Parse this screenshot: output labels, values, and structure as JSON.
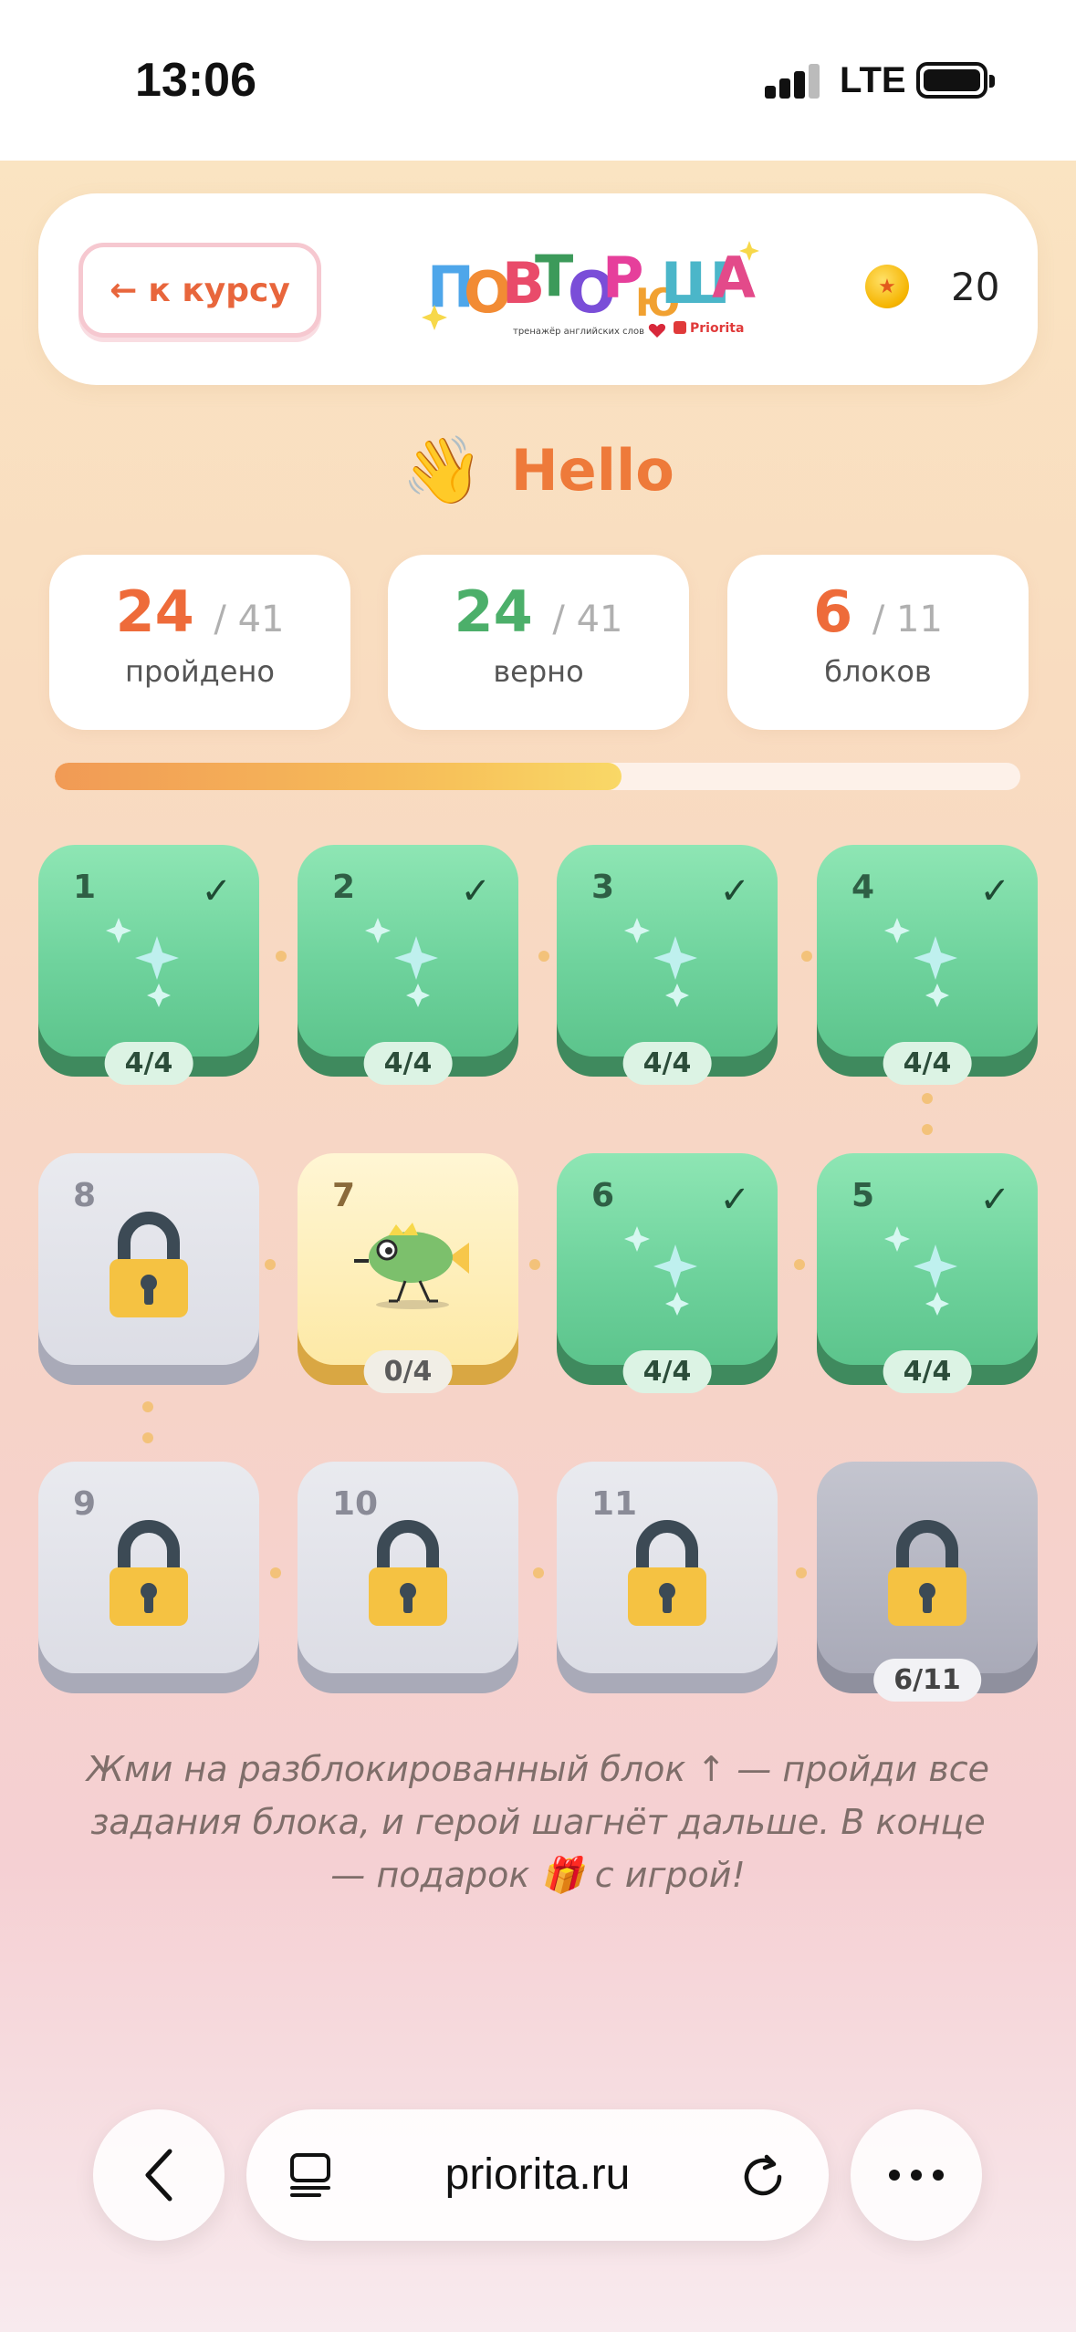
{
  "status_bar": {
    "time": "13:06",
    "network": "LTE"
  },
  "header": {
    "back_label": "к курсу",
    "logo_text": "ПОВТОРЮША",
    "logo_subtitle": "тренажёр английских слов",
    "logo_brand": "Priorita",
    "coins": "20"
  },
  "lesson": {
    "title": "Hello",
    "title_icon": "waving-hand-icon"
  },
  "stats": [
    {
      "value": "24",
      "total": "/ 41",
      "label": "пройдено",
      "color": "#ee6b3a"
    },
    {
      "value": "24",
      "total": "/ 41",
      "label": "верно",
      "color": "#4caf6a"
    },
    {
      "value": "6",
      "total": "/ 11",
      "label": "блоков",
      "color": "#ee6b3a"
    }
  ],
  "progress": {
    "fraction": 0.587
  },
  "tiles": [
    {
      "num": "1",
      "state": "done",
      "badge": "4/4"
    },
    {
      "num": "2",
      "state": "done",
      "badge": "4/4"
    },
    {
      "num": "3",
      "state": "done",
      "badge": "4/4"
    },
    {
      "num": "4",
      "state": "done",
      "badge": "4/4"
    },
    {
      "num": "5",
      "state": "done",
      "badge": "4/4"
    },
    {
      "num": "6",
      "state": "done",
      "badge": "4/4"
    },
    {
      "num": "7",
      "state": "current",
      "badge": "0/4"
    },
    {
      "num": "8",
      "state": "locked",
      "badge": ""
    },
    {
      "num": "9",
      "state": "locked",
      "badge": ""
    },
    {
      "num": "10",
      "state": "locked",
      "badge": ""
    },
    {
      "num": "11",
      "state": "locked",
      "badge": ""
    },
    {
      "num": "",
      "state": "final",
      "badge": "6/11"
    }
  ],
  "hint": "Жми на разблокированный блок ↑ — пройди все задания блока, и герой шагнёт дальше. В конце — подарок 🎁 с игрой!",
  "browser": {
    "url": "priorita.ru"
  }
}
